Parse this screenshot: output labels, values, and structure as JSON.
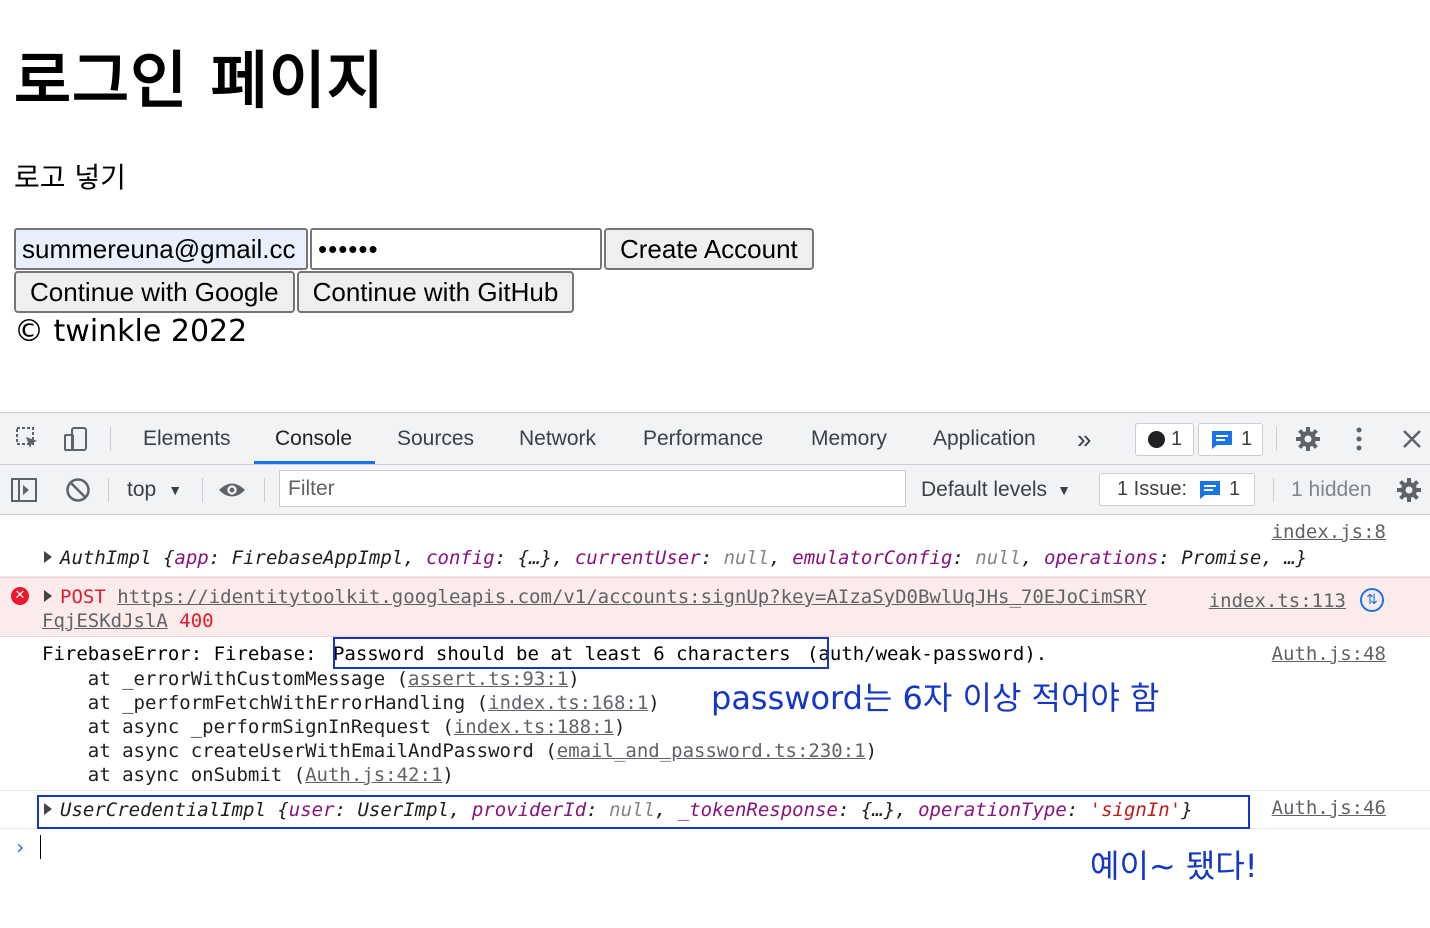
{
  "page": {
    "title": "로그인 페이지",
    "logo_placeholder": "로고 넣기",
    "email_value": "summereuna@gmail.cc",
    "password_mask": "••••••",
    "create_account": "Create Account",
    "google_button": "Continue with Google",
    "github_button": "Continue with GitHub",
    "footer": "© twinkle 2022"
  },
  "devtools": {
    "tabs": [
      "Elements",
      "Console",
      "Sources",
      "Network",
      "Performance",
      "Memory",
      "Application"
    ],
    "active_tab": "Console",
    "more_tabs": "»",
    "errors_count": "1",
    "issues_count": "1",
    "context": "top",
    "filter_placeholder": "Filter",
    "levels": "Default levels",
    "issue_label": "1 Issue:",
    "issue_count": "1",
    "hidden": "1 hidden",
    "accent": "#1a73e8"
  },
  "console": {
    "msg1": {
      "source": "index.js:8",
      "class": "AuthImpl",
      "body_pre": " {",
      "fields": [
        {
          "k": "app",
          "v": "FirebaseAppImpl",
          "t": "obj"
        },
        {
          "k": "config",
          "v": "{…}",
          "t": "obj"
        },
        {
          "k": "currentUser",
          "v": "null",
          "t": "null"
        },
        {
          "k": "emulatorConfig",
          "v": "null",
          "t": "null"
        },
        {
          "k": "operations",
          "v": "Promise",
          "t": "obj"
        }
      ],
      "tail": ", …}"
    },
    "msg2": {
      "method": "POST",
      "url1": "https://identitytoolkit.googleapis.com/v1/accounts:signUp?key=AIzaSyD0BwlUqJHs_70EJoCimSRY",
      "url2": "FqjESKdJslA",
      "status": "400",
      "source": "index.ts:113"
    },
    "msg3": {
      "prefix": "FirebaseError: Firebase: ",
      "highlight": "Password should be at least 6 characters",
      "suffix": " (auth/weak-password).",
      "source": "Auth.js:48",
      "stack": [
        {
          "pre": "    at _errorWithCustomMessage (",
          "link": "assert.ts:93:1",
          "post": ")"
        },
        {
          "pre": "    at _performFetchWithErrorHandling (",
          "link": "index.ts:168:1",
          "post": ")"
        },
        {
          "pre": "    at async _performSignInRequest (",
          "link": "index.ts:188:1",
          "post": ")"
        },
        {
          "pre": "    at async createUserWithEmailAndPassword (",
          "link": "email_and_password.ts:230:1",
          "post": ")"
        },
        {
          "pre": "    at async onSubmit (",
          "link": "Auth.js:42:1",
          "post": ")"
        }
      ],
      "annotation": "password는 6자 이상 적어야 함"
    },
    "msg4": {
      "class": "UserCredentialImpl",
      "user_key": "user",
      "user_val": "UserImpl",
      "provider_key": "providerId",
      "provider_val": "null",
      "token_key": "_tokenResponse",
      "token_val": "{…}",
      "op_key": "operationType",
      "op_val": "'signIn'",
      "source": "Auth.js:46",
      "annotation": "예이~ 됐다!"
    },
    "prompt": "›"
  }
}
